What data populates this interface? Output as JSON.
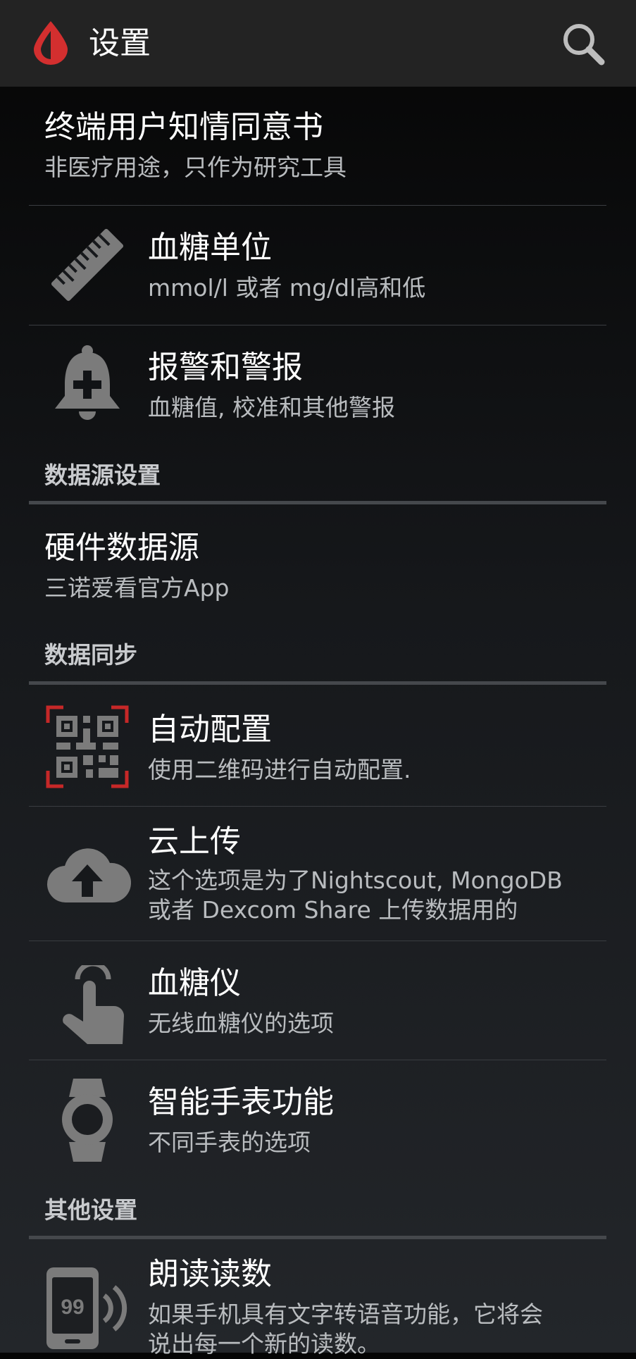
{
  "appbar": {
    "title": "设置",
    "logo_icon": "blood-drop-icon",
    "search_icon": "search-icon",
    "accent_color": "#d32f2f"
  },
  "items": [
    {
      "title": "终端用户知情同意书",
      "summary": "非医疗用途，只作为研究工具",
      "icon": null
    },
    {
      "title": "血糖单位",
      "summary": "mmol/l 或者 mg/dl高和低",
      "icon": "ruler-icon"
    },
    {
      "title": "报警和警报",
      "summary": "血糖值, 校准和其他警报",
      "icon": "bell-plus-icon"
    }
  ],
  "categories": {
    "data_source": "数据源设置",
    "data_sync": "数据同步",
    "other": "其他设置"
  },
  "hardware": {
    "title": "硬件数据源",
    "summary": "三诺爱看官方App"
  },
  "sync_items": [
    {
      "title": "自动配置",
      "summary": "使用二维码进行自动配置.",
      "icon": "qr-code-icon"
    },
    {
      "title": "云上传",
      "summary_line1": "这个选项是为了Nightscout, MongoDB",
      "summary_line2": "或者 Dexcom Share 上传数据用的",
      "icon": "cloud-upload-icon"
    },
    {
      "title": "血糖仪",
      "summary": "无线血糖仪的选项",
      "icon": "touch-hand-icon"
    },
    {
      "title": "智能手表功能",
      "summary": "不同手表的选项",
      "icon": "watch-icon"
    }
  ],
  "other_items": [
    {
      "title": "朗读读数",
      "summary_line1": "如果手机具有文字转语音功能，它将会",
      "summary_line2": "说出每一个新的读数。",
      "icon": "speak-phone-icon",
      "icon_text": "99"
    }
  ]
}
